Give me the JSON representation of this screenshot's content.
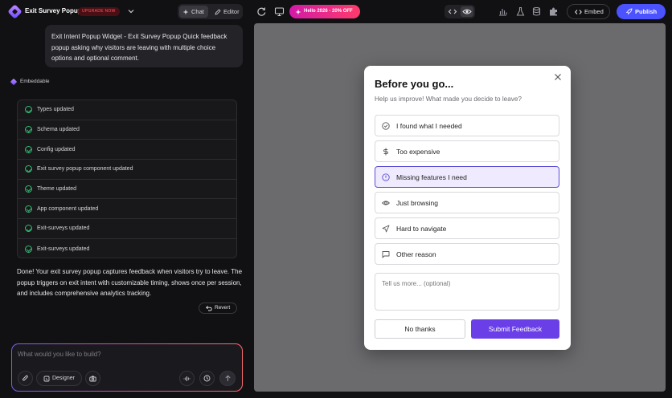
{
  "topbar": {
    "app_title": "Exit Survey Popup",
    "upgrade_label": "UPGRADE NOW",
    "chat_label": "Chat",
    "editor_label": "Editor",
    "promo_label": "Hello 2026 - 20% OFF",
    "embed_label": "Embed",
    "publish_label": "Publish"
  },
  "chat": {
    "user_message": "Exit Intent Popup Widget - Exit Survey Popup Quick feedback popup asking why visitors are leaving with multiple choice options and optional comment.",
    "agent_name": "Embeddable",
    "steps": [
      "Types updated",
      "Schema updated",
      "Config updated",
      "Exit survey popup component updated",
      "Theme updated",
      "App component updated",
      "Exit-surveys updated",
      "Exit-surveys updated"
    ],
    "summary": "Done! Your exit survey popup captures feedback when visitors try to leave. The popup triggers on exit intent with customizable timing, shows once per session, and includes comprehensive analytics tracking.",
    "revert_label": "Revert",
    "composer_placeholder": "What would you like to build?",
    "designer_label": "Designer"
  },
  "popup": {
    "title": "Before you go...",
    "subtitle": "Help us improve! What made you decide to leave?",
    "options": [
      {
        "label": "I found what I needed",
        "icon": "check-circle-icon"
      },
      {
        "label": "Too expensive",
        "icon": "dollar-icon"
      },
      {
        "label": "Missing features I need",
        "icon": "info-circle-icon",
        "selected": true
      },
      {
        "label": "Just browsing",
        "icon": "eye-icon"
      },
      {
        "label": "Hard to navigate",
        "icon": "navigation-arrow-icon"
      },
      {
        "label": "Other reason",
        "icon": "message-square-icon"
      }
    ],
    "comment_placeholder": "Tell us more... (optional)",
    "no_thanks_label": "No thanks",
    "submit_label": "Submit Feedback"
  },
  "colors": {
    "accent": "#6a3fe8",
    "publish": "#4b52ff",
    "success": "#2fbf71",
    "upgrade_text": "#ff5a62"
  }
}
